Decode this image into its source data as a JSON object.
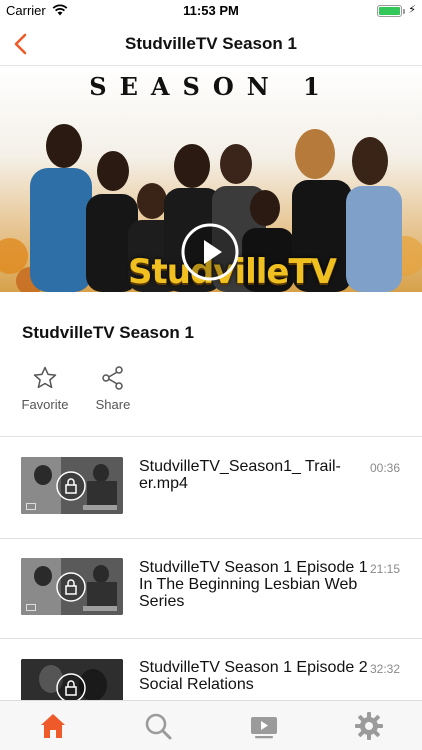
{
  "status_bar": {
    "carrier": "Carrier",
    "time": "11:53 PM"
  },
  "nav": {
    "title": "StudvilleTV Season 1",
    "back_icon": "chevron-left-icon"
  },
  "hero": {
    "banner_heading": "SEASON 1",
    "brand_text": "StudvilleTV",
    "play_icon": "play-icon"
  },
  "detail": {
    "title": "StudvilleTV Season 1"
  },
  "actions": {
    "favorite_label": "Favorite",
    "share_label": "Share"
  },
  "episodes": [
    {
      "title": "StudvilleTV_Season1_ Trail-\ner.mp4",
      "duration": "00:36"
    },
    {
      "title": "StudvilleTV Season 1 Episode 1\nIn The Beginning Lesbian Web\nSeries",
      "duration": "21:15"
    },
    {
      "title": "StudvilleTV Season 1 Episode 2\nSocial Relations",
      "duration": "32:32"
    }
  ],
  "tabs": [
    {
      "icon": "home-icon",
      "active": true
    },
    {
      "icon": "search-icon",
      "active": false
    },
    {
      "icon": "video-icon",
      "active": false
    },
    {
      "icon": "gear-icon",
      "active": false
    }
  ],
  "colors": {
    "accent": "#ef5a2a",
    "inactive_icon": "#9b9b9b",
    "battery": "#34c759"
  }
}
